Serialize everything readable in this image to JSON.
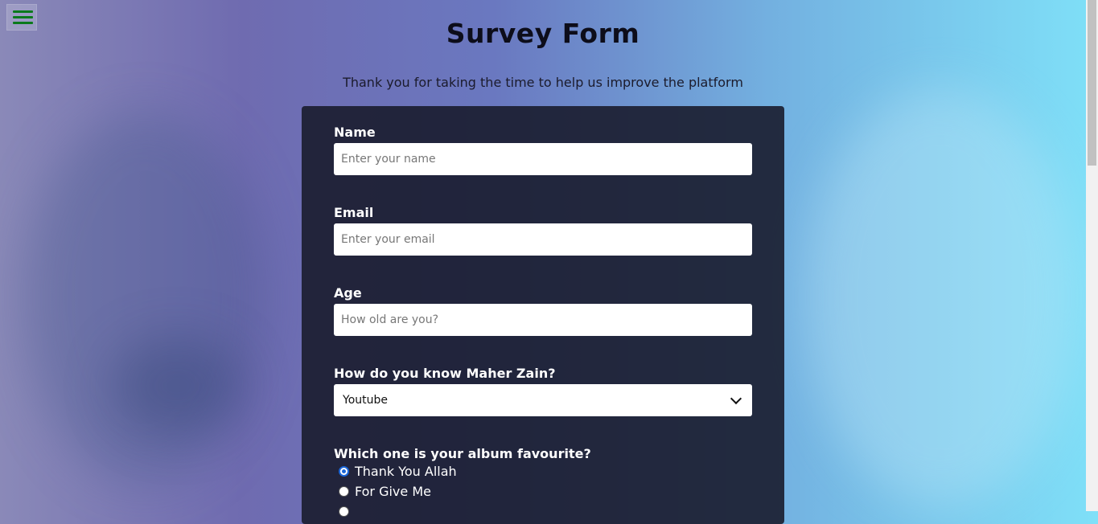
{
  "header": {
    "title": "Survey Form",
    "description": "Thank you for taking the time to help us improve the platform"
  },
  "menu": {
    "icon": "hamburger-menu-icon",
    "color": "#0b7a1c"
  },
  "form": {
    "name": {
      "label": "Name",
      "placeholder": "Enter your name",
      "value": ""
    },
    "email": {
      "label": "Email",
      "placeholder": "Enter your email",
      "value": ""
    },
    "age": {
      "label": "Age",
      "placeholder": "How old are you?",
      "value": ""
    },
    "source": {
      "label": "How do you know Maher Zain?",
      "selected": "Youtube"
    },
    "album": {
      "label": "Which one is your album favourite?",
      "options": [
        {
          "label": "Thank You Allah",
          "checked": true
        },
        {
          "label": "For Give Me",
          "checked": false
        }
      ]
    }
  },
  "colors": {
    "accent_radio": "#1a66d8",
    "form_background": "#191c2d"
  }
}
